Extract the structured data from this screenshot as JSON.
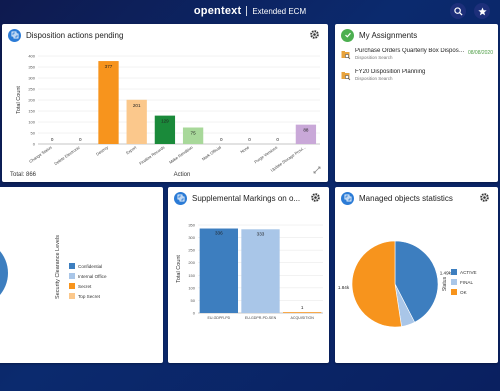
{
  "header": {
    "brand": "opentext",
    "product": "Extended ECM",
    "search_icon": "search-icon",
    "favorites_icon": "star-icon"
  },
  "disposition": {
    "title": "Disposition actions pending",
    "total_label": "Total: 866",
    "icon": "disposition-icon"
  },
  "assignments": {
    "title": "My Assignments",
    "items": [
      {
        "title": "Purchase Orders Quarterly Box Disposi...",
        "subtitle": "Disposition Search",
        "date": "08/08/2020"
      },
      {
        "title": "FY20 Disposition Planning",
        "subtitle": "Disposition Search",
        "date": ""
      }
    ]
  },
  "supplemental": {
    "title": "Supplemental Markings on o..."
  },
  "managed": {
    "title": "Managed objects statistics"
  },
  "chart_data": [
    {
      "type": "bar",
      "title": "Disposition actions pending",
      "xlabel": "Action",
      "ylabel": "Total Count",
      "categories": [
        "Change Status",
        "Delete Electronic",
        "Destroy",
        "Export",
        "Finalize Records",
        "Make Rendition",
        "Mark Official",
        "None",
        "Purge Versions",
        "Update Storage Provi..."
      ],
      "values": [
        0,
        0,
        377,
        201,
        129,
        75,
        0,
        0,
        0,
        88
      ],
      "colors": [
        "#f7941d",
        "#f7941d",
        "#f7941d",
        "#fbc88c",
        "#1a8a3a",
        "#a8d89a",
        "#a8d89a",
        "#a8d89a",
        "#a8d89a",
        "#c9a8d8"
      ],
      "ylim": [
        0,
        400
      ],
      "yticks": [
        0,
        50,
        100,
        150,
        200,
        250,
        300,
        350,
        400
      ],
      "grid": true
    },
    {
      "type": "bar",
      "title": "Supplemental Markings on o...",
      "ylabel": "Total Count",
      "categories": [
        "EU-GDPR-PD",
        "EU-GDPR-PD-SEN",
        "ACQUISITION"
      ],
      "values": [
        336,
        333,
        1
      ],
      "colors": [
        "#3d7ebf",
        "#a9c6e8",
        "#f7941d"
      ],
      "ylim": [
        0,
        350
      ],
      "yticks": [
        0,
        50,
        100,
        150,
        200,
        250,
        300,
        350
      ],
      "grid": true
    },
    {
      "type": "pie",
      "title": "Managed objects statistics",
      "legend_title": "Status",
      "legend_position": "right",
      "labels": [
        "ACTIVE",
        "FINAL",
        "OK"
      ],
      "values": [
        1490,
        180,
        1840
      ],
      "value_labels": [
        "1.49k",
        "",
        "1.84k"
      ],
      "colors": [
        "#3d7ebf",
        "#a9c6e8",
        "#f7941d"
      ]
    },
    {
      "type": "pie",
      "legend_title": "Security Clearance Levels",
      "labels": [
        "Confidential",
        "Internal Office",
        "Secret",
        "Top Secret"
      ],
      "colors": [
        "#3d7ebf",
        "#a9c6e8",
        "#f7941d",
        "#fbc88c"
      ]
    }
  ]
}
